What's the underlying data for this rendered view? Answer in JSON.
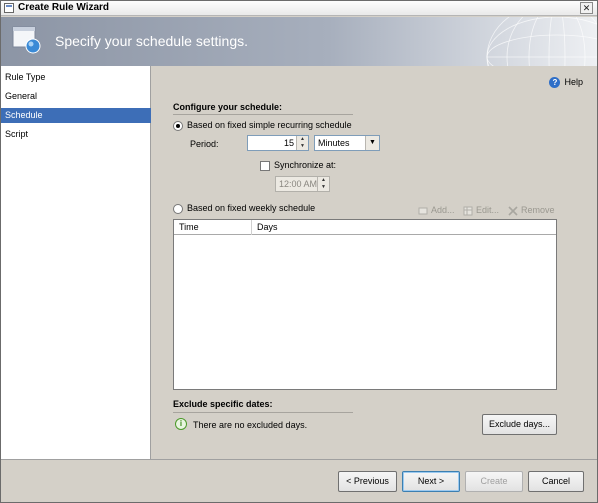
{
  "window": {
    "title": "Create Rule Wizard",
    "close_glyph": "✕"
  },
  "banner": {
    "title": "Specify your schedule settings."
  },
  "nav": {
    "items": [
      {
        "label": "Rule Type",
        "active": false
      },
      {
        "label": "General",
        "active": false
      },
      {
        "label": "Schedule",
        "active": true
      },
      {
        "label": "Script",
        "active": false
      }
    ]
  },
  "help": {
    "label": "Help",
    "icon_glyph": "?"
  },
  "schedule": {
    "section_title": "Configure your schedule:",
    "option_recurring": "Based on fixed simple recurring schedule",
    "period_label": "Period:",
    "period_value": "15",
    "period_unit": "Minutes",
    "sync_label": "Synchronize at:",
    "sync_time": "12:00 AM",
    "option_weekly": "Based on fixed weekly schedule",
    "recurring_selected": true,
    "weekly_selected": false,
    "sync_checked": false
  },
  "toolbar": {
    "add_label": "Add...",
    "edit_label": "Edit...",
    "remove_label": "Remove"
  },
  "table": {
    "columns": [
      "Time",
      "Days"
    ],
    "rows": []
  },
  "exclude": {
    "section_title": "Exclude specific dates:",
    "info_glyph": "i",
    "info_text": "There are no excluded days.",
    "button_label": "Exclude days..."
  },
  "footer": {
    "previous_label": "< Previous",
    "next_label": "Next >",
    "create_label": "Create",
    "cancel_label": "Cancel"
  },
  "colors": {
    "nav_selected": "#3d6eb7",
    "panel_bg": "#d4d0c8"
  }
}
